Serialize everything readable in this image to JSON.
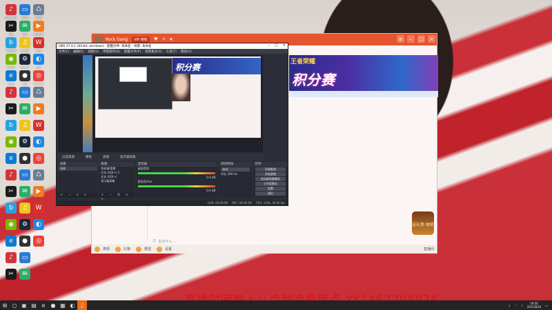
{
  "desktop": {
    "icons": [
      {
        "label": "网易云音乐",
        "color": "#d3343c",
        "glyph": "♪"
      },
      {
        "label": "此电脑",
        "color": "#2b7bd6",
        "glyph": "▭"
      },
      {
        "label": "回收站",
        "color": "#6b7d93",
        "glyph": "♺"
      },
      {
        "label": "剪映",
        "color": "#1b1b1b",
        "glyph": "✂"
      },
      {
        "label": "微信",
        "color": "#2aae67",
        "glyph": "✉"
      },
      {
        "label": "腾讯视频",
        "color": "#f27b1e",
        "glyph": "▶"
      },
      {
        "label": "哔哩哔哩",
        "color": "#27a2e1",
        "glyph": "b"
      },
      {
        "label": "QQ音乐",
        "color": "#f2c319",
        "glyph": "♫"
      },
      {
        "label": "WPS",
        "color": "#d6312c",
        "glyph": "W"
      },
      {
        "label": "NVIDIA",
        "color": "#76b900",
        "glyph": "◉"
      },
      {
        "label": "Steam",
        "color": "#1b2838",
        "glyph": "⚙"
      },
      {
        "label": "QQ",
        "color": "#1e88e5",
        "glyph": "◐"
      },
      {
        "label": "Edge",
        "color": "#0c7bd6",
        "glyph": "e"
      },
      {
        "label": "OBS",
        "color": "#2f3136",
        "glyph": "●"
      },
      {
        "label": "Chrome",
        "color": "#e9443a",
        "glyph": "◎"
      }
    ]
  },
  "chat": {
    "name": "Rock Gang",
    "badge": "VIP 特权",
    "banner_small": "王者荣耀",
    "banner_big": "积分赛",
    "input_placeholder": "说点什么...",
    "toolbar": [
      "表情",
      "礼物",
      "赠送",
      "设置"
    ],
    "toolbar_right": "直播间",
    "gift_label": "送礼物 抽奖"
  },
  "obs": {
    "title": "OBS 27.0.1 (64-bit, windows) - 配置文件: 未命名 - 场景: 未命名",
    "menu": [
      "文件(F)",
      "编辑(E)",
      "视图(V)",
      "停靠部件(D)",
      "配置文件(P)",
      "场景集合(S)",
      "工具(T)",
      "帮助(H)"
    ],
    "controls_bar": [
      "已选来源",
      "属性",
      "滤镜",
      "显示器采集"
    ],
    "scenes_header": "场景",
    "scenes": [
      "场景"
    ],
    "sources_header": "来源",
    "sources": [
      "色彩源/背景",
      "文本 (GDI+) 2",
      "文本 (GDI+)",
      "显示器采集"
    ],
    "mixer_header": "混音器",
    "mixer": [
      {
        "name": "桌面音频",
        "level": "0.0 dB"
      },
      {
        "name": "麦克风/Aux",
        "level": "0.0 dB"
      }
    ],
    "transitions_header": "转场特效",
    "transition_name": "淡出",
    "transition_duration_label": "时长",
    "transition_duration": "300 ms",
    "controls_header": "控件",
    "controls": [
      "开始推流",
      "开始录制",
      "启动虚拟摄像机",
      "工作室模式",
      "设置",
      "退出"
    ],
    "status": [
      "LIVE: 00:00:00",
      "REC: 00:00:00",
      "CPU: 3.6%, 30.00 fps"
    ]
  },
  "overlay_text": "直播时间晚上八点到凌晨俩点 YY1462208976",
  "taskbar": {
    "time": "19:50",
    "date": "2021/8/24"
  }
}
